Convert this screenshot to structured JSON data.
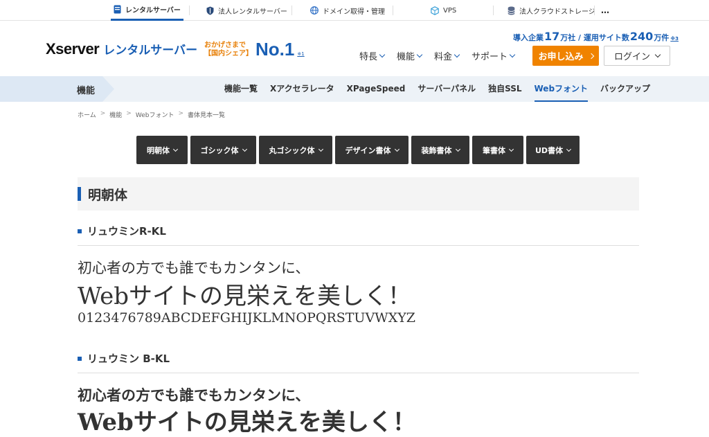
{
  "topbar": {
    "items": [
      {
        "label": "レンタルサーバー",
        "icon": "server-icon"
      },
      {
        "label": "法人レンタルサーバー",
        "icon": "shield-icon"
      },
      {
        "label": "ドメイン取得・管理",
        "icon": "globe-icon"
      },
      {
        "label": "VPS",
        "icon": "cube-icon"
      },
      {
        "label": "法人クラウドストレージ",
        "icon": "database-icon"
      }
    ],
    "more": "…"
  },
  "header": {
    "logo_main": "Xserver",
    "logo_sub": "レンタルサーバー",
    "badge_line1": "おかげさまで",
    "badge_line2": "【国内シェア】",
    "badge_big": "No.1",
    "badge_note": "※1",
    "stats": {
      "p1": "導入企業",
      "n1": "17",
      "p2": "万社 / 運用サイト数",
      "n2": "240",
      "p3": "万件",
      "note": "※3"
    },
    "nav": [
      "特長",
      "機能",
      "料金",
      "サポート"
    ],
    "apply_label": "お申し込み",
    "login_label": "ログイン"
  },
  "subnav": {
    "section": "機能",
    "items": [
      "機能一覧",
      "Xアクセラレータ",
      "XPageSpeed",
      "サーバーパネル",
      "独自SSL",
      "Webフォント",
      "バックアップ"
    ],
    "active_index": 5
  },
  "breadcrumb": [
    "ホーム",
    "機能",
    "Webフォント",
    "書体見本一覧"
  ],
  "tabs": [
    "明朝体",
    "ゴシック体",
    "丸ゴシック体",
    "デザイン書体",
    "装飾書体",
    "筆書体",
    "UD書体"
  ],
  "section_title": "明朝体",
  "fonts": [
    {
      "name": "リュウミンR-KL",
      "sample1": "初心者の方でも誰でもカンタンに、",
      "sample2": "Webサイトの見栄えを美しく！",
      "sample3": "0123476789ABCDEFGHIJKLMNOPQRSTUVWXYZ"
    },
    {
      "name": "リュウミン B-KL",
      "sample1": "初心者の方でも誰でもカンタンに、",
      "sample2": "Webサイトの見栄えを美しく！"
    }
  ],
  "colors": {
    "brand": "#1a5fb4",
    "accent": "#f08300",
    "dark": "#333333"
  }
}
